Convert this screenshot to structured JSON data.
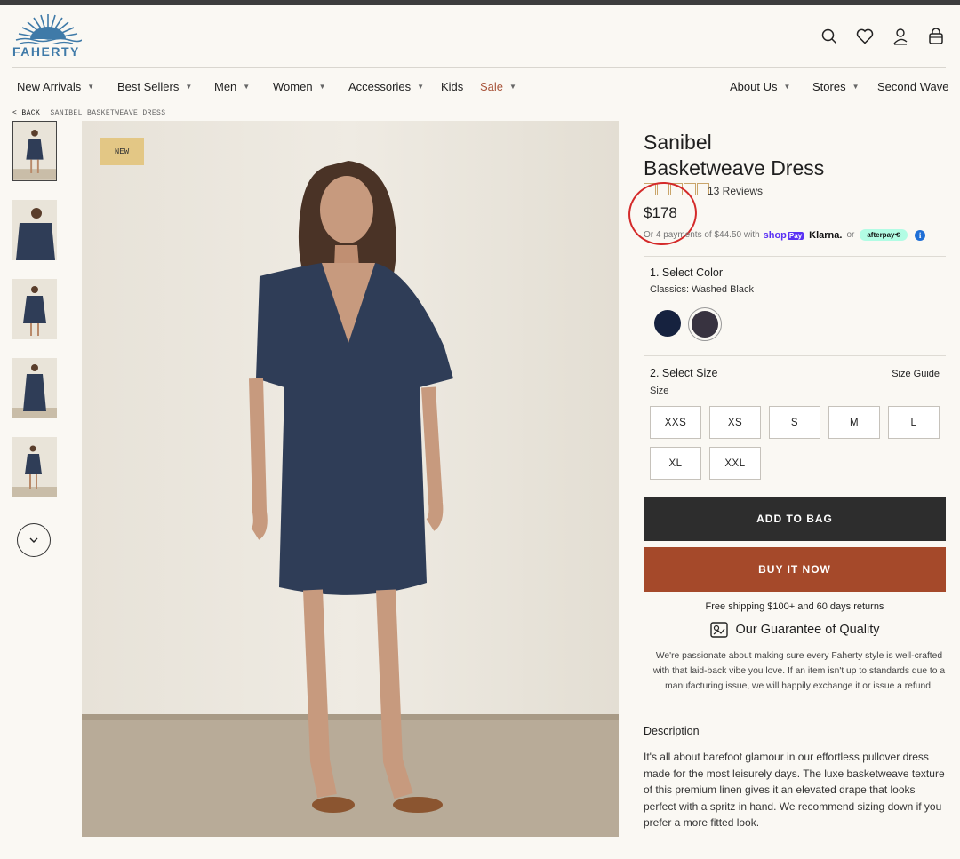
{
  "brand": {
    "name": "FAHERTY",
    "color": "#3f7aa8"
  },
  "header": {
    "icons": [
      "search-icon",
      "heart-icon",
      "account-icon",
      "bag-icon"
    ]
  },
  "nav": {
    "items": [
      {
        "label": "New Arrivals",
        "dropdown": true
      },
      {
        "label": "Best Sellers",
        "dropdown": true
      },
      {
        "label": "Men",
        "dropdown": true
      },
      {
        "label": "Women",
        "dropdown": true
      },
      {
        "label": "Accessories",
        "dropdown": true
      },
      {
        "label": "Kids",
        "dropdown": false
      },
      {
        "label": "Sale",
        "dropdown": true
      },
      {
        "label": "About Us",
        "dropdown": true
      },
      {
        "label": "Stores",
        "dropdown": true
      },
      {
        "label": "Second Wave",
        "dropdown": false
      }
    ],
    "caret": "▼",
    "sale_color": "#a8543a"
  },
  "breadcrumb": {
    "back": "< BACK",
    "current": "SANIBEL BASKETWEAVE DRESS"
  },
  "gallery": {
    "badge": "NEW",
    "thumbnail_count": 5
  },
  "product": {
    "title_line1": "Sanibel",
    "title_line2": "Basketweave Dress",
    "rating_stars": 5,
    "reviews": "13 Reviews",
    "price": "$178",
    "installments": "Or 4 payments of $44.50 with",
    "shop_pay": "shop",
    "shop_pay_tag": "Pay",
    "klarna": "Klarna.",
    "or": "or",
    "afterpay": "afterpay⟲",
    "info": "i"
  },
  "color": {
    "heading": "1. Select Color",
    "selected": "Classics: Washed Black",
    "swatches": [
      {
        "name": "navy",
        "hex": "#16223f"
      },
      {
        "name": "washed-black",
        "hex": "#383340"
      }
    ]
  },
  "size": {
    "heading": "2. Select Size",
    "label": "Size",
    "guide": "Size Guide",
    "options": [
      "XXS",
      "XS",
      "S",
      "M",
      "L",
      "XL",
      "XXL"
    ]
  },
  "actions": {
    "add_to_bag": "ADD TO BAG",
    "buy_now": "BUY IT NOW"
  },
  "shipping": "Free shipping $100+ and 60 days returns",
  "guarantee": {
    "title": "Our Guarantee of Quality",
    "text": "We're passionate about making sure every Faherty style is well-crafted with that laid-back vibe you love. If an item isn't up to standards due to a manufacturing issue, we will happily exchange it or issue a refund."
  },
  "description": {
    "heading": "Description",
    "text": "It's all about barefoot glamour in our effortless pullover dress made for the most leisurely days. The luxe basketweave texture of this premium linen gives it an elevated drape that looks perfect with a spritz in hand. We recommend sizing down if you prefer a more fitted look."
  }
}
